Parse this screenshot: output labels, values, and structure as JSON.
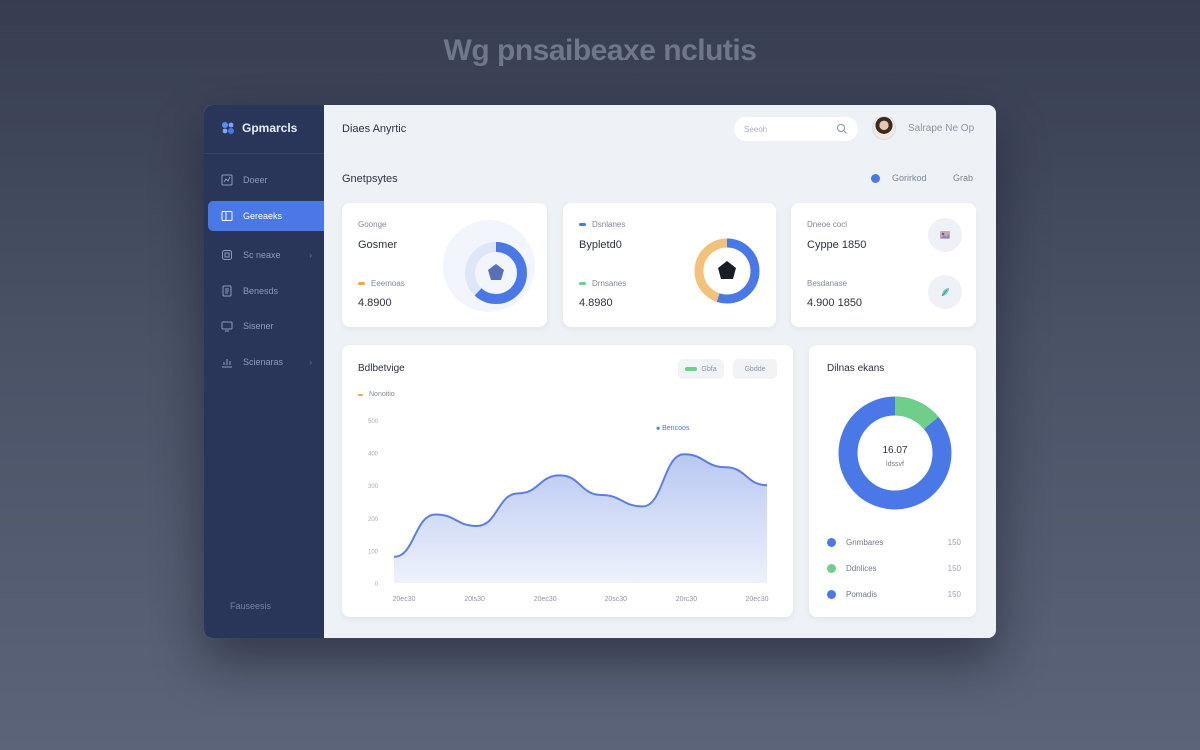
{
  "headline": "Wg pnsaibeaxe nclutis",
  "sidebar": {
    "brand": "Gpmarcls",
    "items": [
      {
        "label": "Doeer",
        "icon": "chart-icon",
        "active": false,
        "chevron": ""
      },
      {
        "label": "Gereaeks",
        "icon": "folder-icon",
        "active": true,
        "chevron": ""
      },
      {
        "label": "Sc neaxe",
        "icon": "box-icon",
        "active": false,
        "chevron": "›"
      },
      {
        "label": "Benesds",
        "icon": "document-icon",
        "active": false,
        "chevron": ""
      },
      {
        "label": "Sisener",
        "icon": "monitor-icon",
        "active": false,
        "chevron": ""
      },
      {
        "label": "Scienaras",
        "icon": "stats-icon",
        "active": false,
        "chevron": "›"
      }
    ],
    "footer": "Fauseesis"
  },
  "topbar": {
    "title": "Diaes Anyrtic",
    "search_placeholder": "Seeoh",
    "user_name": "Salrape Ne Op"
  },
  "section": {
    "title": "Gnetpsytes",
    "filter_a": "Gorirkod",
    "filter_b": "Grab"
  },
  "kpi_cards": [
    {
      "top_label": "Goonge",
      "top_value": "Gosmer",
      "bottom_label": "Eeemoas",
      "bottom_value": "4.8900",
      "bottom_marker": "#e9a94a",
      "donut": {
        "color": "#4a78e6",
        "track": "#dfe6f7",
        "fraction": 0.62,
        "center": "#5a6fb5"
      }
    },
    {
      "top_label": "Dsnlanes",
      "top_value": "Bypletd0",
      "top_marker": "#4a78e6",
      "bottom_label": "Drnsanes",
      "bottom_value": "4.8980",
      "bottom_marker": "#6fcf8a",
      "donut": {
        "color": "#4a78e6",
        "track": "#f0c27b",
        "fraction": 0.55,
        "center": "#1a1d26"
      }
    },
    {
      "top_label": "Dneoe cocl",
      "top_value": "Cyppe 1850",
      "bottom_label": "Besdanase",
      "bottom_value": "4.900 1850",
      "icons": [
        "image-icon",
        "leaf-icon"
      ]
    }
  ],
  "trend_card": {
    "title": "Bdlbetvige",
    "toggle_a": "Gbfa",
    "toggle_b": "Gbdde",
    "legend_label": "Nonoitio",
    "series_label": "Bencoos",
    "colors": {
      "line": "#5b7fe0",
      "fill_top": "#b9c8f2",
      "fill_bottom": "#eef2fc"
    },
    "chart_data": {
      "type": "area",
      "x": [
        "20ec30",
        "20ls30",
        "20ec30",
        "20sc30",
        "20rc30",
        "20ec30"
      ],
      "y_ticks": [
        "0",
        "100",
        "200",
        "300",
        "400",
        "500"
      ],
      "ylim": [
        0,
        500
      ],
      "values": [
        80,
        210,
        175,
        275,
        330,
        270,
        235,
        395,
        355,
        300
      ]
    }
  },
  "donut_card": {
    "title": "Dilnas ekans",
    "center_value": "16.07",
    "center_sub": "ldssvf",
    "chart_data": {
      "type": "pie",
      "slices": [
        {
          "label": "Gnmbares",
          "value": 150,
          "color": "#4a78e6"
        },
        {
          "label": "Ddnlices",
          "value": 150,
          "color": "#6fcf8a"
        },
        {
          "label": "Pomadis",
          "value": 150,
          "color": "#4a78e6"
        }
      ],
      "ring_fractions": [
        0.86,
        0.14
      ]
    }
  }
}
